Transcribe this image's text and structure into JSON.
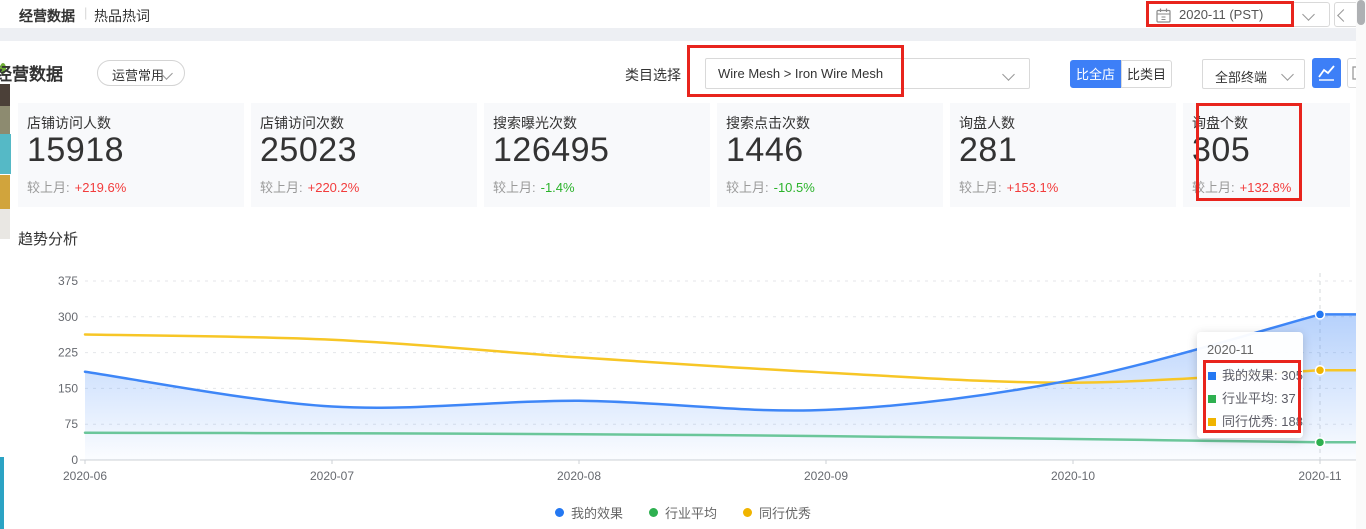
{
  "colors": {
    "accent": "#3D7FF7",
    "annotation_red": "#E8241D",
    "up_red": "#F23C3C",
    "down_green": "#2BB32B",
    "band_gray": "#EDEFF3"
  },
  "topbar": {
    "tab_operation_data": "经营数据",
    "tab_separator": "|",
    "tab_hot_words": "热品热词",
    "date_value": "2020-11 (PST)"
  },
  "toolbar": {
    "title": "经营数据",
    "preset": "运营常用",
    "category_label": "类目选择",
    "category_value": "Wire Mesh > Iron Wire Mesh",
    "btn_compare_store": "比全店",
    "btn_compare_category": "比类目",
    "terminal": "全部终端"
  },
  "stats": [
    {
      "label": "店铺访问人数",
      "value": "15918",
      "mom_label": "较上月:",
      "mom": "+219.6%",
      "dir": "up"
    },
    {
      "label": "店铺访问次数",
      "value": "25023",
      "mom_label": "较上月:",
      "mom": "+220.2%",
      "dir": "up"
    },
    {
      "label": "搜索曝光次数",
      "value": "126495",
      "mom_label": "较上月:",
      "mom": "-1.4%",
      "dir": "down"
    },
    {
      "label": "搜索点击次数",
      "value": "1446",
      "mom_label": "较上月:",
      "mom": "-10.5%",
      "dir": "down"
    },
    {
      "label": "询盘人数",
      "value": "281",
      "mom_label": "较上月:",
      "mom": "+153.1%",
      "dir": "up"
    },
    {
      "label": "询盘个数",
      "value": "305",
      "mom_label": "较上月:",
      "mom": "+132.8%",
      "dir": "up"
    }
  ],
  "chart_data": {
    "type": "line",
    "title": "趋势分析",
    "categories": [
      "2020-06",
      "2020-07",
      "2020-08",
      "2020-09",
      "2020-10",
      "2020-11"
    ],
    "series": [
      {
        "name": "我的效果",
        "color": "#3E86F7",
        "marker": "#2478F2",
        "area": true,
        "values": [
          185,
          112,
          124,
          105,
          168,
          305
        ]
      },
      {
        "name": "行业平均",
        "color": "#6BC69A",
        "marker": "#2EB050",
        "area": false,
        "values": [
          57,
          56,
          54,
          50,
          44,
          37
        ]
      },
      {
        "name": "同行优秀",
        "color": "#F7C626",
        "marker": "#F0B400",
        "area": false,
        "values": [
          263,
          252,
          215,
          183,
          162,
          188
        ]
      }
    ],
    "ylim": [
      0,
      375
    ],
    "yticks": [
      0,
      75,
      150,
      225,
      300,
      375
    ],
    "grid": "horizontal-dashed",
    "legend_position": "bottom",
    "hover_index": 5,
    "tooltip": {
      "title": "2020-11",
      "rows": [
        {
          "label": "我的效果:",
          "value": "305"
        },
        {
          "label": "行业平均:",
          "value": "37"
        },
        {
          "label": "同行优秀:",
          "value": "188"
        }
      ]
    }
  }
}
